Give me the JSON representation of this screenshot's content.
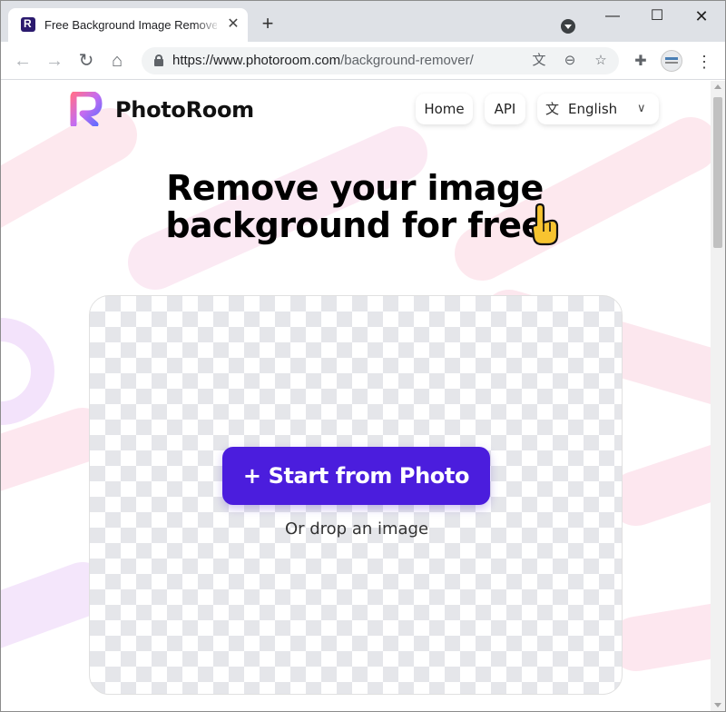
{
  "browser": {
    "tab_title": "Free Background Image Remover",
    "tab_close": "✕",
    "new_tab": "+",
    "url_host": "https://www.photoroom.com",
    "url_path": "/background-remover/"
  },
  "site": {
    "brand": "PhotoRoom",
    "nav": {
      "home": "Home",
      "api": "API",
      "language": "English"
    },
    "headline_line1": "Remove your image",
    "headline_line2": "background for free",
    "start_button": "+ Start from Photo",
    "drop_text": "Or drop an image"
  },
  "colors": {
    "primary_button": "#4b1ddd",
    "checker": "#e5e6ea",
    "decor_pink": "#fde6ec",
    "decor_purple": "#f2e6fb"
  }
}
